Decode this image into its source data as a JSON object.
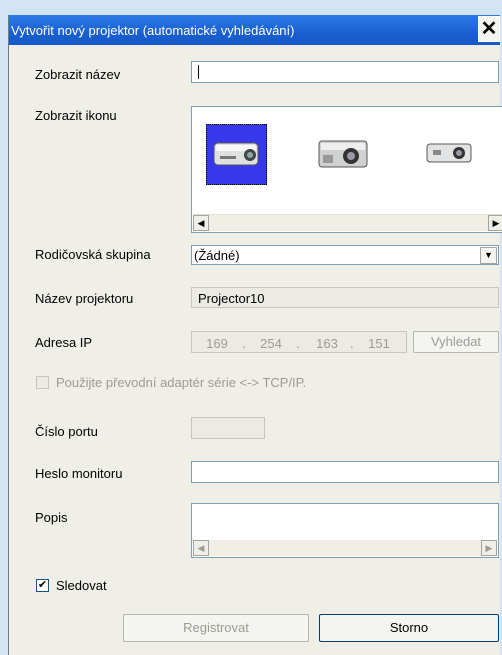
{
  "window": {
    "title": "Vytvořit nový projektor (automatické vyhledávání)"
  },
  "form": {
    "display_name_label": "Zobrazit název",
    "display_name_value": "",
    "display_icon_label": "Zobrazit ikonu",
    "parent_group_label": "Rodičovská skupina",
    "parent_group_value": "(Žádné)",
    "projector_name_label": "Název projektoru",
    "projector_name_value": "Projector10",
    "ip_label": "Adresa IP",
    "ip": [
      "169",
      "254",
      "163",
      "151"
    ],
    "search_button": "Vyhledat",
    "serial_adapter_label": "Použijte převodní adaptér série <-> TCP/IP.",
    "port_label": "Číslo portu",
    "port_value": "",
    "monitor_password_label": "Heslo monitoru",
    "monitor_password_value": "",
    "description_label": "Popis",
    "description_value": "",
    "monitor_label": "Sledovat",
    "monitor_checked": true
  },
  "buttons": {
    "register": "Registrovat",
    "cancel": "Storno"
  },
  "icons": [
    "projector-small-icon",
    "projector-large-icon",
    "projector-compact-icon"
  ],
  "colors": {
    "title_bar": "#1a5fd0",
    "selection": "#3737ec",
    "background": "#d2e4f6"
  }
}
